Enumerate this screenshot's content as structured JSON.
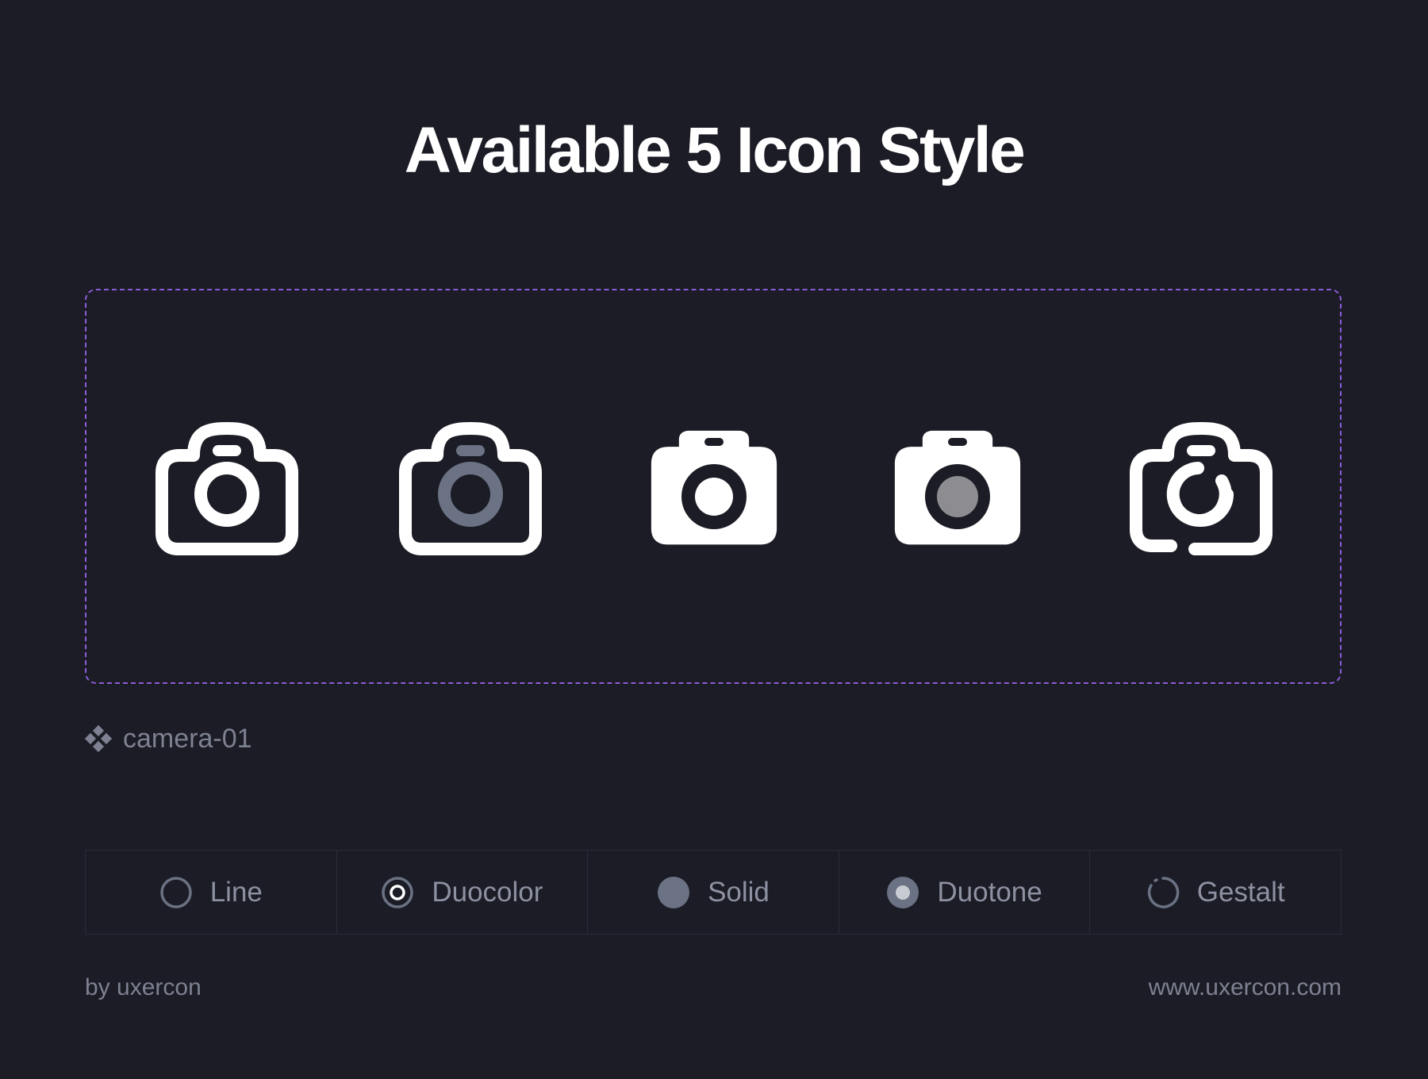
{
  "header": {
    "title": "Available 5 Icon Style"
  },
  "preview": {
    "icons": [
      {
        "style": "line",
        "icon": "camera-line-icon"
      },
      {
        "style": "duocolor",
        "icon": "camera-duocolor-icon"
      },
      {
        "style": "solid",
        "icon": "camera-solid-icon"
      },
      {
        "style": "duotone",
        "icon": "camera-duotone-icon"
      },
      {
        "style": "gestalt",
        "icon": "camera-gestalt-icon"
      }
    ],
    "border_color": "#8a5cd8"
  },
  "icon_name": {
    "icon": "component-icon",
    "label": "camera-01"
  },
  "style_tabs": [
    {
      "label": "Line",
      "icon": "circle-outline-icon"
    },
    {
      "label": "Duocolor",
      "icon": "circle-duocolor-icon"
    },
    {
      "label": "Solid",
      "icon": "circle-solid-icon"
    },
    {
      "label": "Duotone",
      "icon": "circle-duotone-icon"
    },
    {
      "label": "Gestalt",
      "icon": "circle-gestalt-icon"
    }
  ],
  "footer": {
    "author": "by uxercon",
    "website": "www.uxercon.com"
  },
  "colors": {
    "background": "#1b1c25",
    "foreground": "#ffffff",
    "muted": "#7d8191",
    "secondary_tone": "#6a7283",
    "accent": "#8a5cd8"
  }
}
